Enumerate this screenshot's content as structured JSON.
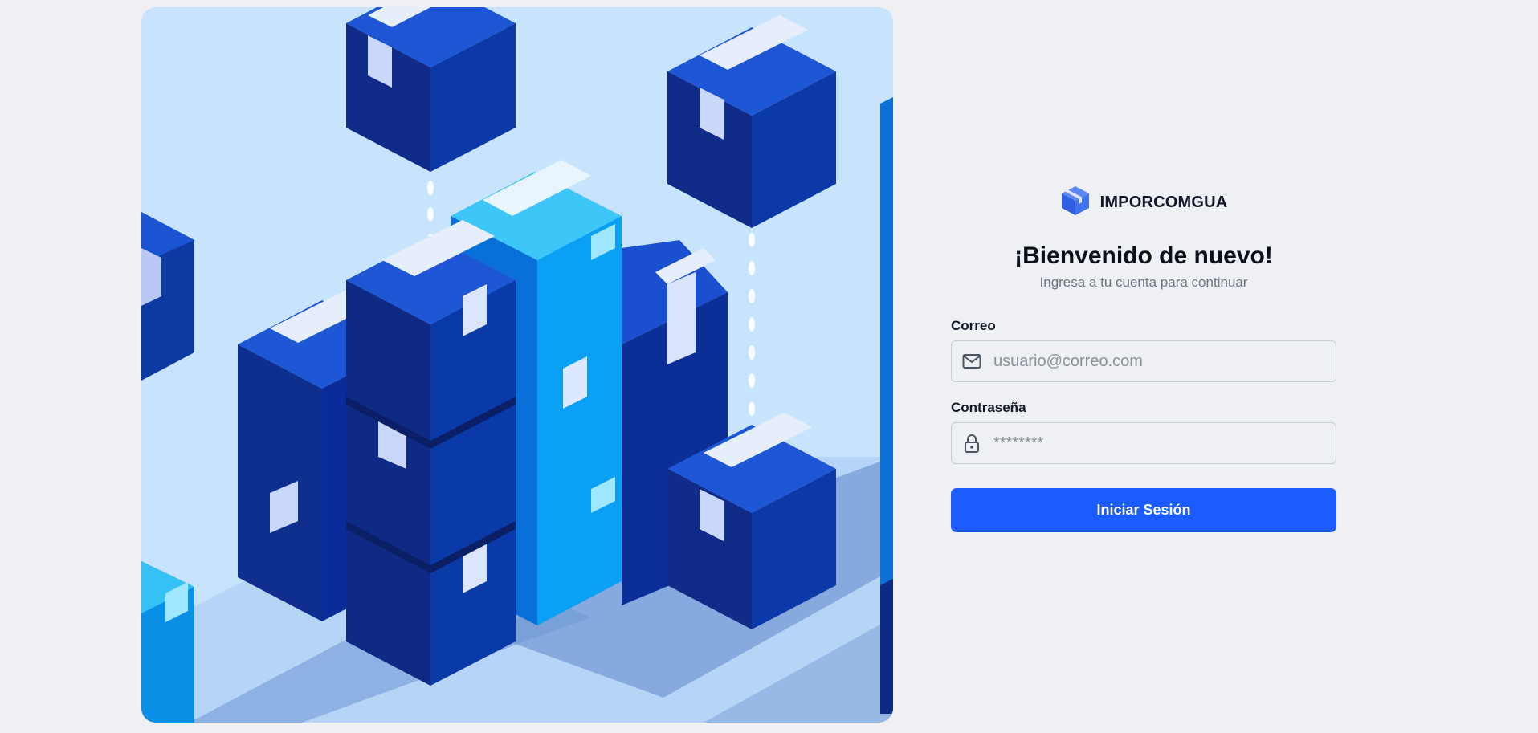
{
  "brand": {
    "name": "IMPORCOMGUA",
    "icon": "package-box-icon",
    "accent": "#3a6df0"
  },
  "hero": {
    "illustration": "isometric-stacked-boxes-illustration"
  },
  "login": {
    "title": "¡Bienvenido de nuevo!",
    "subtitle": "Ingresa a tu cuenta para continuar",
    "email_label": "Correo",
    "email_placeholder": "usuario@correo.com",
    "email_icon": "mail-icon",
    "password_label": "Contraseña",
    "password_placeholder": "********",
    "password_icon": "lock-icon",
    "submit_label": "Iniciar Sesión",
    "submit_color": "#1a5cff"
  }
}
